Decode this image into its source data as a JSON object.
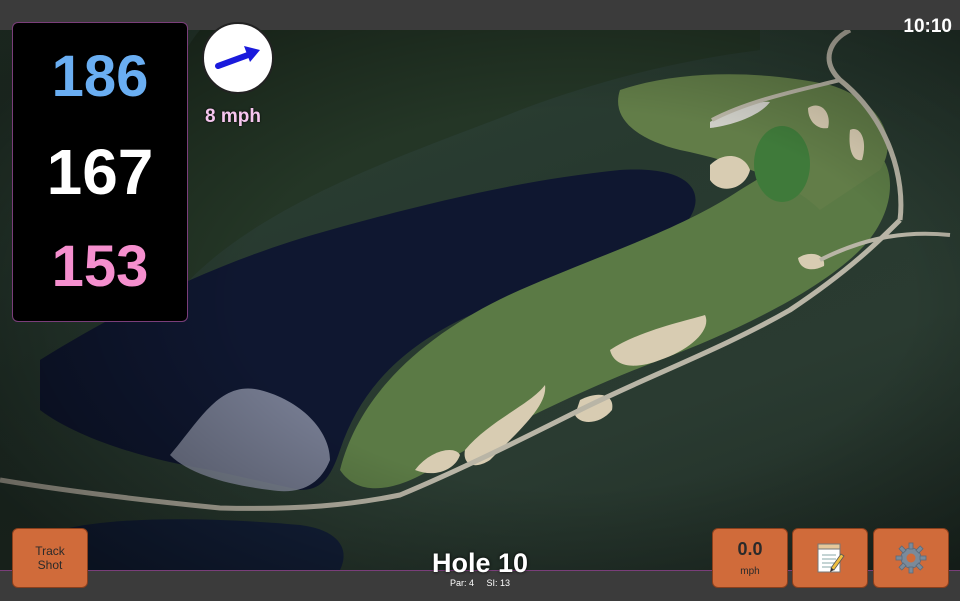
{
  "status_bar": {
    "time": "10:10"
  },
  "yardages": {
    "back": "186",
    "middle": "167",
    "front": "153"
  },
  "wind": {
    "speed": "8 mph",
    "icon": "wind-arrow-icon",
    "arrow_color": "#1a1adc"
  },
  "hole": {
    "title": "Hole 10",
    "par": "Par: 4",
    "stroke_index": "SI: 13"
  },
  "buttons": {
    "track_shot_line1": "Track",
    "track_shot_line2": "Shot",
    "speed_value": "0.0",
    "speed_unit": "mph",
    "notes_icon": "notepad-icon",
    "settings_icon": "gear-icon"
  },
  "colors": {
    "back_yardage": "#6aaef2",
    "middle_yardage": "#ffffff",
    "front_yardage": "#f58fce",
    "button_bg": "#d06b3a",
    "accent_border": "#7a3e7a"
  }
}
